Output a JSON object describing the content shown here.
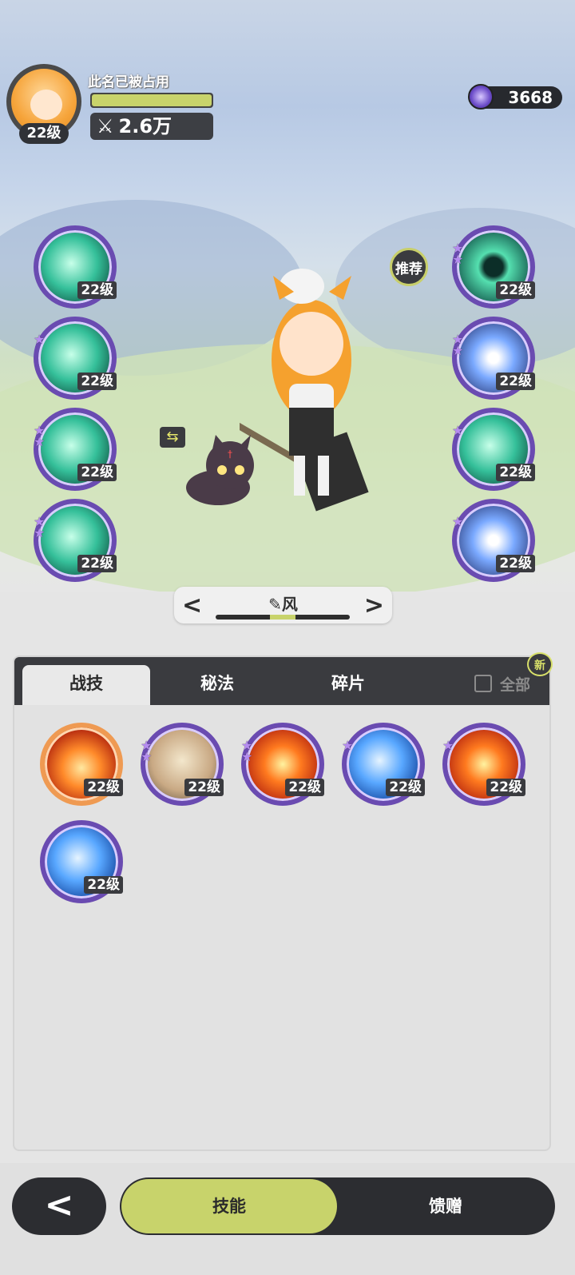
{
  "player": {
    "name": "此名已被占用",
    "level_badge": "22级",
    "power": "2.6万",
    "xp_fill": 1.0
  },
  "currency": {
    "amount": "3668"
  },
  "recommend_label": "推荐",
  "left_skills": [
    {
      "level": "22级",
      "stars": 0
    },
    {
      "level": "22级",
      "stars": 1
    },
    {
      "level": "22级",
      "stars": 2
    },
    {
      "level": "22级",
      "stars": 2
    }
  ],
  "right_skills": [
    {
      "level": "22级",
      "stars": 2
    },
    {
      "level": "22级",
      "stars": 2
    },
    {
      "level": "22级",
      "stars": 1
    },
    {
      "level": "22级",
      "stars": 1
    }
  ],
  "element_switch": {
    "label": "风",
    "prev": "<",
    "next": ">"
  },
  "tabs": [
    {
      "label": "战技",
      "active": true
    },
    {
      "label": "秘法",
      "active": false
    },
    {
      "label": "碎片",
      "active": false
    }
  ],
  "filter": {
    "label": "全部",
    "new_badge": "新"
  },
  "grid_skills": [
    {
      "level": "22级"
    },
    {
      "level": "22级"
    },
    {
      "level": "22级"
    },
    {
      "level": "22级"
    },
    {
      "level": "22级"
    },
    {
      "level": "22级"
    }
  ],
  "bottom_nav": {
    "back": "<",
    "items": [
      {
        "label": "技能",
        "active": true
      },
      {
        "label": "馈赠",
        "active": false
      }
    ]
  },
  "colors": {
    "accent": "#c8d36b",
    "dark": "#2c2d31",
    "skill_ring": "#6a4bb1"
  }
}
